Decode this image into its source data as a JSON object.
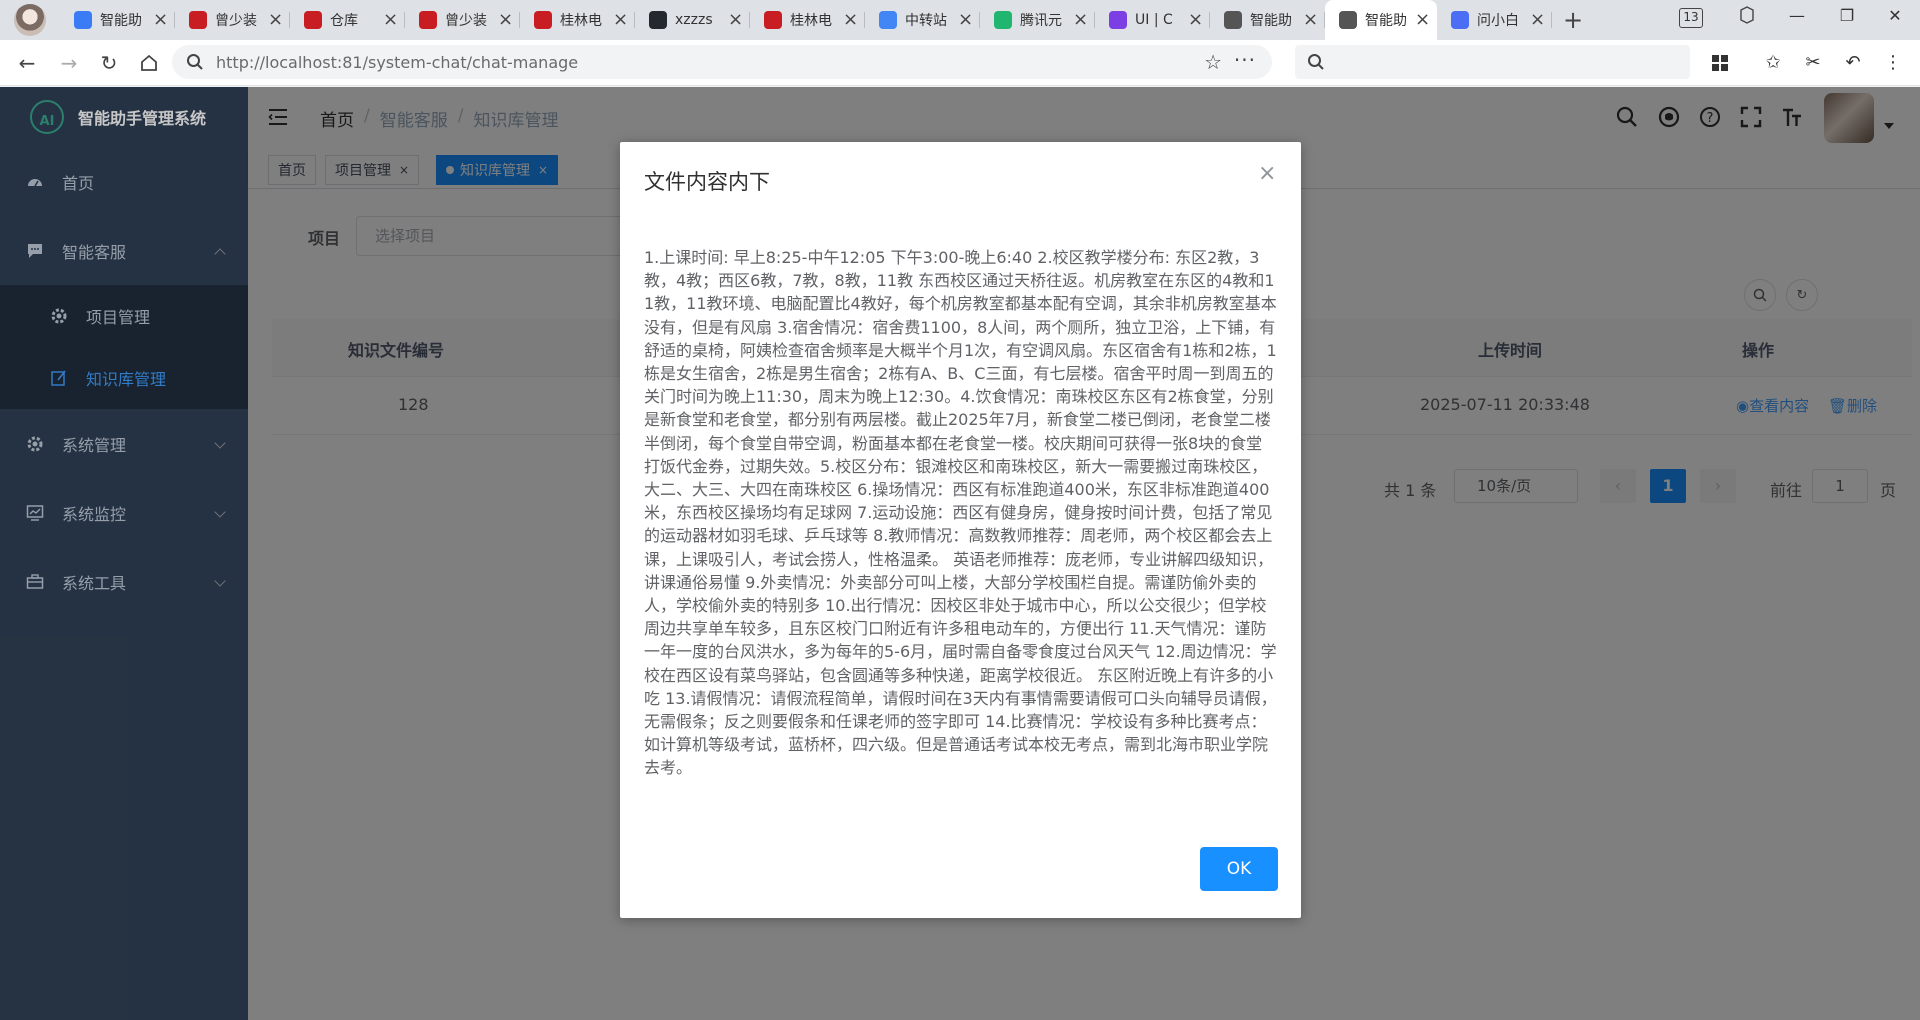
{
  "browser": {
    "tabs": [
      {
        "title": "智能助",
        "icon": "robot-icon",
        "color": "#3a7bf6"
      },
      {
        "title": "曾少装",
        "icon": "gitee-icon",
        "color": "#c71d23"
      },
      {
        "title": "仓库",
        "icon": "gitee-icon",
        "color": "#c71d23"
      },
      {
        "title": "曾少装",
        "icon": "gitee-icon",
        "color": "#c71d23"
      },
      {
        "title": "桂林电",
        "icon": "gitee-icon",
        "color": "#c71d23"
      },
      {
        "title": "xzzzs",
        "icon": "github-icon",
        "color": "#24292f"
      },
      {
        "title": "桂林电",
        "icon": "gitee-icon",
        "color": "#c71d23"
      },
      {
        "title": "中转站",
        "icon": "chrome-icon",
        "color": "#4285f4"
      },
      {
        "title": "腾讯元",
        "icon": "tencent-icon",
        "color": "#21b66f"
      },
      {
        "title": "UI | C",
        "icon": "shield-icon",
        "color": "#7b3fe4"
      },
      {
        "title": "智能助",
        "icon": "globe-icon",
        "color": "#555555"
      },
      {
        "title": "智能助",
        "icon": "globe-icon",
        "color": "#555555",
        "active": true
      },
      {
        "title": "问小白",
        "icon": "chat-icon",
        "color": "#4c6ef5"
      }
    ],
    "tab_count": "13",
    "url": "http://localhost:81/system-chat/chat-manage"
  },
  "app": {
    "brand": {
      "logo_text": "AI",
      "name": "智能助手管理系统"
    },
    "sidebar": {
      "home": "首页",
      "service": "智能客服",
      "sub": [
        {
          "label": "项目管理"
        },
        {
          "label": "知识库管理"
        }
      ],
      "system": "系统管理",
      "monitor": "系统监控",
      "tools": "系统工具"
    },
    "breadcrumb": [
      "首页",
      "智能客服",
      "知识库管理"
    ],
    "tags": [
      "首页",
      "项目管理",
      "知识库管理"
    ],
    "filter": {
      "label": "项目",
      "placeholder": "选择项目"
    },
    "table": {
      "headers": {
        "id": "知识文件编号",
        "time": "上传时间",
        "ops": "操作"
      },
      "rows": [
        {
          "id": "128",
          "time": "2025-07-11 20:33:48",
          "view": "查看内容",
          "delete": "删除"
        }
      ]
    },
    "pagination": {
      "total": "共 1 条",
      "page_size": "10条/页",
      "current": "1",
      "goto_label": "前往",
      "goto_value": "1",
      "page_suffix": "页"
    }
  },
  "dialog": {
    "title": "文件内容内下",
    "content": "1.上课时间: 早上8:25-中午12:05 下午3:00-晚上6:40 2.校区教学楼分布: 东区2教，3教，4教；西区6教，7教，8教，11教 东西校区通过天桥往返。机房教室在东区的4教和11教，11教环境、电脑配置比4教好，每个机房教室都基本配有空调，其余非机房教室基本没有，但是有风扇 3.宿舍情况：宿舍费1100，8人间，两个厕所，独立卫浴，上下铺，有舒适的桌椅，阿姨检查宿舍频率是大概半个月1次，有空调风扇。东区宿舍有1栋和2栋，1栋是女生宿舍，2栋是男生宿舍；2栋有A、B、C三面，有七层楼。宿舍平时周一到周五的关门时间为晚上11:30，周末为晚上12:30。4.饮食情况：南珠校区东区有2栋食堂，分别是新食堂和老食堂，都分别有两层楼。截止2025年7月，新食堂二楼已倒闭，老食堂二楼半倒闭，每个食堂自带空调，粉面基本都在老食堂一楼。校庆期间可获得一张8块的食堂打饭代金券，过期失效。5.校区分布：银滩校区和南珠校区，新大一需要搬过南珠校区，大二、大三、大四在南珠校区 6.操场情况：西区有标准跑道400米，东区非标准跑道400米，东西校区操场均有足球网 7.运动设施：西区有健身房，健身按时间计费，包括了常见的运动器材如羽毛球、乒乓球等 8.教师情况：高数教师推荐：周老师，两个校区都会去上课，上课吸引人，考试会捞人，性格温柔。 英语老师推荐：庞老师，专业讲解四级知识，讲课通俗易懂 9.外卖情况：外卖部分可叫上楼，大部分学校围栏自提。需谨防偷外卖的人，学校偷外卖的特别多 10.出行情况：因校区非处于城市中心，所以公交很少；但学校周边共享单车较多，且东区校门口附近有许多租电动车的，方便出行 11.天气情况：谨防一年一度的台风洪水，多为每年的5-6月，届时需自备零食度过台风天气 12.周边情况：学校在西区设有菜鸟驿站，包含圆通等多种快递，距离学校很近。 东区附近晚上有许多的小吃 13.请假情况：请假流程简单，请假时间在3天内有事情需要请假可口头向辅导员请假，无需假条；反之则要假条和任课老师的签字即可 14.比赛情况：学校设有多种比赛考点：如计算机等级考试，蓝桥杯，四六级。但是普通话考试本校无考点，需到北海市职业学院去考。",
    "ok": "OK"
  },
  "colors": {
    "primary": "#1890ff",
    "sidebar_bg": "#304156",
    "submenu_bg": "#1f2d3d",
    "active_text": "#409eff"
  }
}
